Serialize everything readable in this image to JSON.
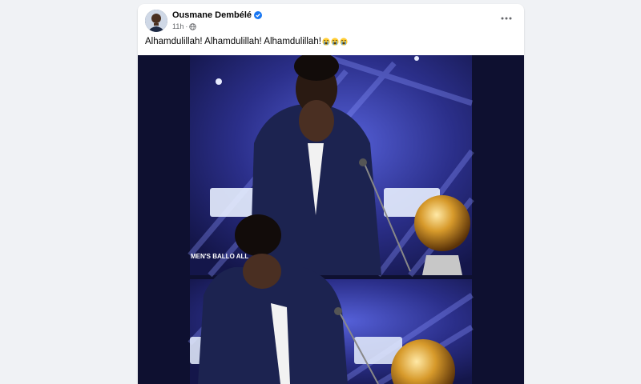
{
  "post": {
    "author": "Ousmane Dembélé",
    "time": "11h",
    "caption": "Alhamdulillah! Alhamdulillah! Alhamdulillah!",
    "emoji_icons": [
      "loudly-crying-face-icon",
      "loudly-crying-face-icon",
      "loudly-crying-face-icon"
    ],
    "photo_overlay_text": "MEN'S BALLO                    ALL"
  },
  "colors": {
    "page_bg": "#f0f2f5",
    "card_bg": "#ffffff",
    "verified_badge": "#1877f2",
    "secondary_text": "#65676b",
    "stage_bg": "#0e1030"
  },
  "icons": {
    "verified": "verified-badge-icon",
    "audience": "globe-icon",
    "menu": "more-options-icon"
  }
}
